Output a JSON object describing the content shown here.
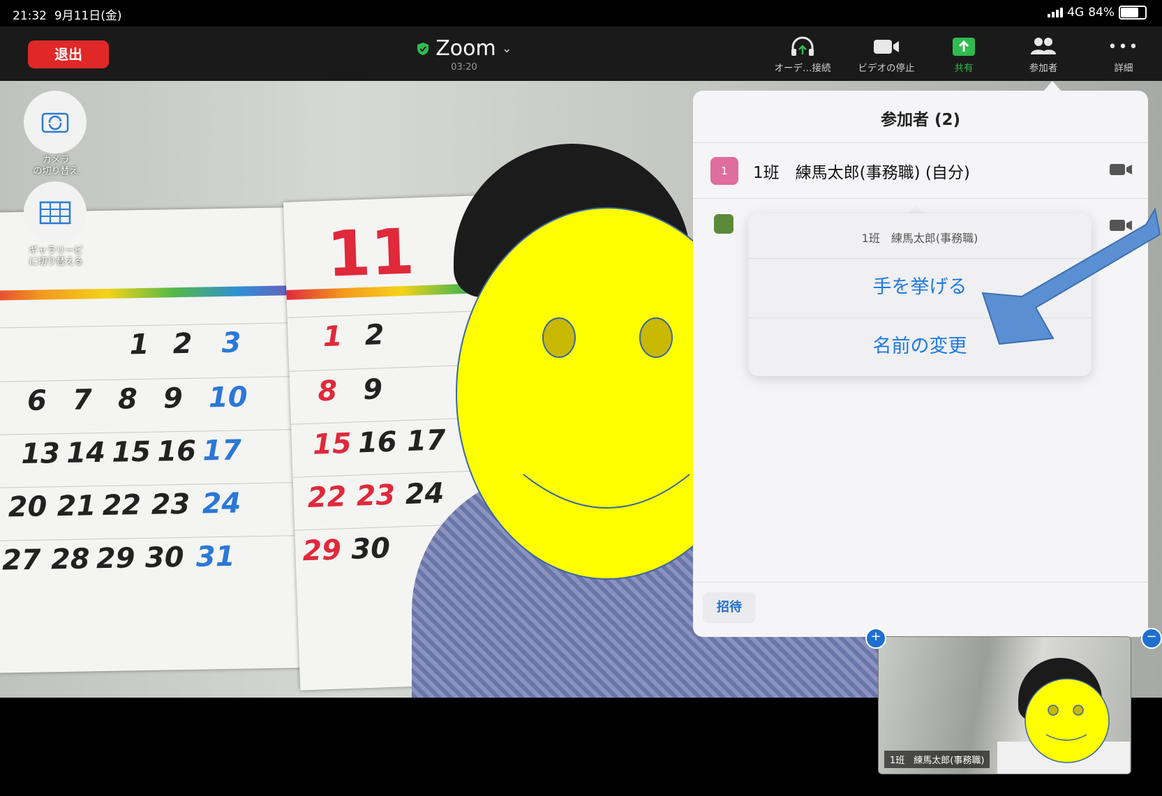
{
  "status_bar": {
    "time": "21:32",
    "date": "9月11日(金)",
    "network": "4G",
    "battery": "84%",
    "battery_level": 0.84
  },
  "toolbar": {
    "leave_label": "退出",
    "meeting_title": "Zoom",
    "elapsed": "03:20",
    "items": [
      {
        "label": "オーデ…接続",
        "icon": "headphones-icon"
      },
      {
        "label": "ビデオの停止",
        "icon": "video-camera-icon"
      },
      {
        "label": "共有",
        "icon": "share-arrow-icon"
      },
      {
        "label": "参加者",
        "icon": "participants-icon"
      },
      {
        "label": "詳細",
        "icon": "more-dots-icon"
      }
    ]
  },
  "side_controls": {
    "switch_camera": "カメラ\nの切り替え",
    "gallery_view": "ギャラリービ\nに切り替える"
  },
  "participants_panel": {
    "title": "参加者 (2)",
    "participants": [
      {
        "avatar_text": "1",
        "name": "1班　練馬太郎(事務職) (自分)"
      }
    ],
    "invite_label": "招待"
  },
  "context_menu": {
    "header": "1班　練馬太郎(事務職)",
    "items": [
      "手を挙げる",
      "名前の変更"
    ]
  },
  "self_view": {
    "name_label": "1班　練馬太郎(事務職)"
  },
  "colors": {
    "leave": "#e02828",
    "share": "#2fbb4f",
    "menu_link": "#1f7ae0",
    "arrow": "#5b8fd3",
    "smiley": "#ffff00"
  }
}
